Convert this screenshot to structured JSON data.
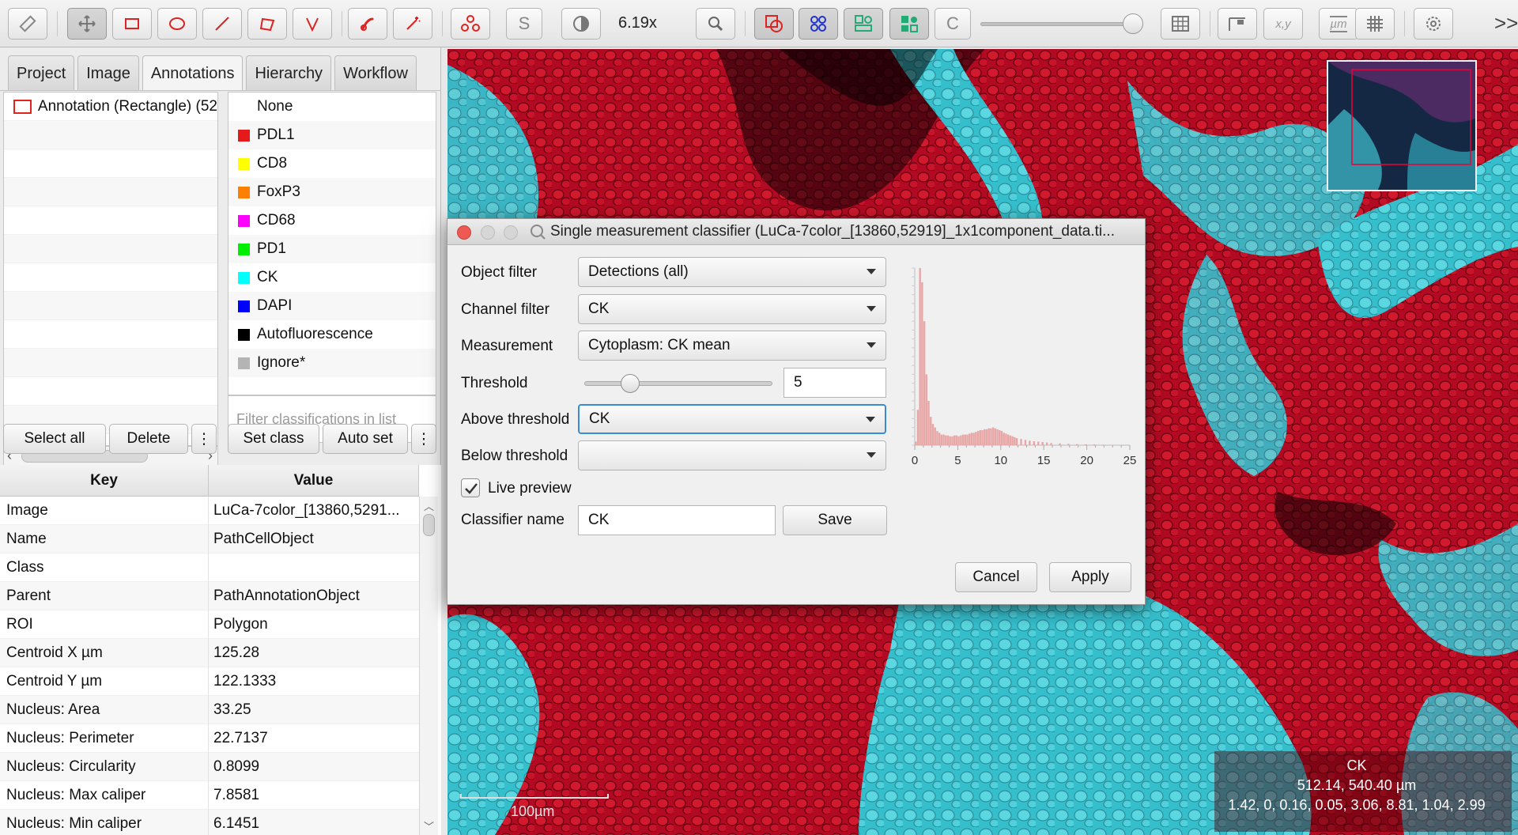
{
  "toolbar": {
    "zoom": "6.19x",
    "s_label": "S",
    "c_label": "C",
    "xy_label": "x,y",
    "um_label": "µm",
    "more": ">>"
  },
  "tabs": [
    "Project",
    "Image",
    "Annotations",
    "Hierarchy",
    "Workflow"
  ],
  "annotations": {
    "items": [
      "Annotation (Rectangle) (52"
    ],
    "select_all": "Select all",
    "delete": "Delete",
    "menu": "⋮"
  },
  "classes": {
    "items": [
      {
        "name": "None",
        "color": ""
      },
      {
        "name": "PDL1",
        "color": "#e41a1c"
      },
      {
        "name": "CD8",
        "color": "#ffff00"
      },
      {
        "name": "FoxP3",
        "color": "#ff7f00"
      },
      {
        "name": "CD68",
        "color": "#ff00ff"
      },
      {
        "name": "PD1",
        "color": "#00ee00"
      },
      {
        "name": "CK",
        "color": "#00ffff"
      },
      {
        "name": "DAPI",
        "color": "#0000ff"
      },
      {
        "name": "Autofluorescence",
        "color": "#000000"
      },
      {
        "name": "Ignore*",
        "color": "#b4b4b4"
      }
    ],
    "filter_placeholder": "Filter classifications in list",
    "set_class": "Set class",
    "auto_set": "Auto set",
    "menu": "⋮"
  },
  "properties": {
    "headers": {
      "key": "Key",
      "value": "Value"
    },
    "rows": [
      {
        "key": "Image",
        "value": "LuCa-7color_[13860,5291..."
      },
      {
        "key": "Name",
        "value": "PathCellObject"
      },
      {
        "key": "Class",
        "value": ""
      },
      {
        "key": "Parent",
        "value": "PathAnnotationObject"
      },
      {
        "key": "ROI",
        "value": "Polygon"
      },
      {
        "key": "Centroid X µm",
        "value": "125.28"
      },
      {
        "key": "Centroid Y µm",
        "value": "122.1333"
      },
      {
        "key": "Nucleus: Area",
        "value": "33.25"
      },
      {
        "key": "Nucleus: Perimeter",
        "value": "22.7137"
      },
      {
        "key": "Nucleus: Circularity",
        "value": "0.8099"
      },
      {
        "key": "Nucleus: Max caliper",
        "value": "7.8581"
      },
      {
        "key": "Nucleus: Min caliper",
        "value": "6.1451"
      }
    ]
  },
  "viewer": {
    "scalebar": "100µm",
    "info_channel": "CK",
    "info_coords": "512.14, 540.40 µm",
    "info_values": "1.42, 0, 0.16, 0.05, 3.06, 8.81, 1.04, 2.99"
  },
  "dialog": {
    "title": "Single measurement classifier (LuCa-7color_[13860,52919]_1x1component_data.ti...",
    "object_filter_label": "Object filter",
    "object_filter_value": "Detections (all)",
    "channel_filter_label": "Channel filter",
    "channel_filter_value": "CK",
    "measurement_label": "Measurement",
    "measurement_value": "Cytoplasm: CK mean",
    "threshold_label": "Threshold",
    "threshold_value": "5",
    "above_label": "Above threshold",
    "above_value": "CK",
    "below_label": "Below threshold",
    "below_value": "",
    "live_preview_label": "Live preview",
    "live_preview_checked": true,
    "classifier_name_label": "Classifier name",
    "classifier_name_value": "CK",
    "save": "Save",
    "cancel": "Cancel",
    "apply": "Apply"
  },
  "chart_data": {
    "type": "bar",
    "title": "",
    "xlabel": "",
    "ylabel": "",
    "xlim": [
      0,
      25
    ],
    "xticks": [
      "0",
      "5",
      "10",
      "15",
      "20",
      "25"
    ],
    "color": "#e8a7a7",
    "bin_width": 0.25,
    "x": [
      0.25,
      0.5,
      0.75,
      1,
      1.25,
      1.5,
      1.75,
      2,
      2.25,
      2.5,
      2.75,
      3,
      3.25,
      3.5,
      3.75,
      4,
      4.25,
      4.5,
      4.75,
      5,
      5.25,
      5.5,
      5.75,
      6,
      6.25,
      6.5,
      6.75,
      7,
      7.25,
      7.5,
      7.75,
      8,
      8.25,
      8.5,
      8.75,
      9,
      9.25,
      9.5,
      9.75,
      10,
      10.25,
      10.5,
      10.75,
      11,
      11.25,
      11.5,
      11.75,
      12,
      12.5,
      13,
      13.5,
      14,
      14.5,
      15,
      15.5,
      16,
      17,
      18,
      19,
      20,
      21,
      22,
      23
    ],
    "values": [
      2,
      20,
      100,
      92,
      70,
      40,
      25,
      16,
      12,
      10,
      8,
      7,
      6,
      6,
      5.5,
      5.5,
      5,
      5,
      5.5,
      5.5,
      5,
      5.5,
      6,
      6,
      6,
      6.5,
      7,
      7,
      7.5,
      8,
      8.5,
      8.5,
      9,
      9,
      9.5,
      9.5,
      10,
      9.5,
      9,
      8.5,
      8,
      7,
      6.5,
      6,
      5.5,
      5,
      4.5,
      4,
      3.5,
      3,
      2.5,
      2.2,
      2,
      1.8,
      1.5,
      1.2,
      1,
      0.8,
      0.6,
      0.5,
      0.4,
      0.3,
      0.2
    ]
  }
}
